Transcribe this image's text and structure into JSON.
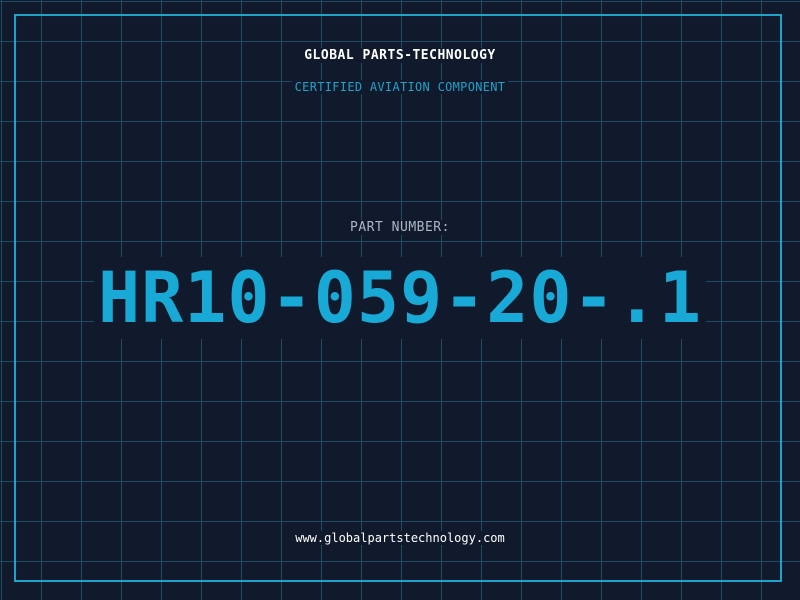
{
  "header": {
    "company": "GLOBAL PARTS-TECHNOLOGY",
    "tagline": "CERTIFIED AVIATION COMPONENT"
  },
  "part": {
    "label": "PART NUMBER:",
    "number": "HR10-059-20-.1"
  },
  "footer": {
    "website": "www.globalpartstechnology.com"
  },
  "colors": {
    "background": "#111a2c",
    "grid": "#1e4a63",
    "accent": "#1fa2c9",
    "part_number": "#18a9d6"
  }
}
